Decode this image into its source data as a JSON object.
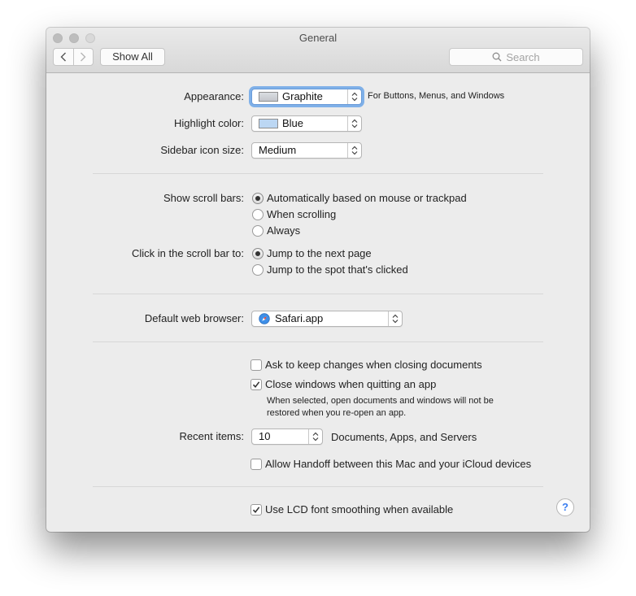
{
  "window": {
    "title": "General",
    "toolbar": {
      "show_all_label": "Show All",
      "search_placeholder": "Search"
    }
  },
  "appearance": {
    "label": "Appearance:",
    "value": "Graphite",
    "note": "For Buttons, Menus, and Windows",
    "swatch_color": "#c4c7cc"
  },
  "highlight": {
    "label": "Highlight color:",
    "value": "Blue",
    "swatch_color": "#bcd7f3"
  },
  "sidebar_icon": {
    "label": "Sidebar icon size:",
    "value": "Medium"
  },
  "scroll_bars": {
    "label": "Show scroll bars:",
    "options": [
      "Automatically based on mouse or trackpad",
      "When scrolling",
      "Always"
    ],
    "selected": 0
  },
  "click_scroll": {
    "label": "Click in the scroll bar to:",
    "options": [
      "Jump to the next page",
      "Jump to the spot that's clicked"
    ],
    "selected": 0
  },
  "browser": {
    "label": "Default web browser:",
    "value": "Safari.app"
  },
  "checkboxes": {
    "ask_keep_changes": {
      "label": "Ask to keep changes when closing documents",
      "checked": false
    },
    "close_windows": {
      "label": "Close windows when quitting an app",
      "checked": true,
      "description_line1": "When selected, open documents and windows will not be",
      "description_line2": "restored when you re-open an app."
    },
    "handoff": {
      "label": "Allow Handoff between this Mac and your iCloud devices",
      "checked": false
    },
    "lcd_smoothing": {
      "label": "Use LCD font smoothing when available",
      "checked": true
    }
  },
  "recent_items": {
    "label": "Recent items:",
    "value": "10",
    "suffix": "Documents, Apps, and Servers"
  },
  "help": {
    "symbol": "?"
  }
}
